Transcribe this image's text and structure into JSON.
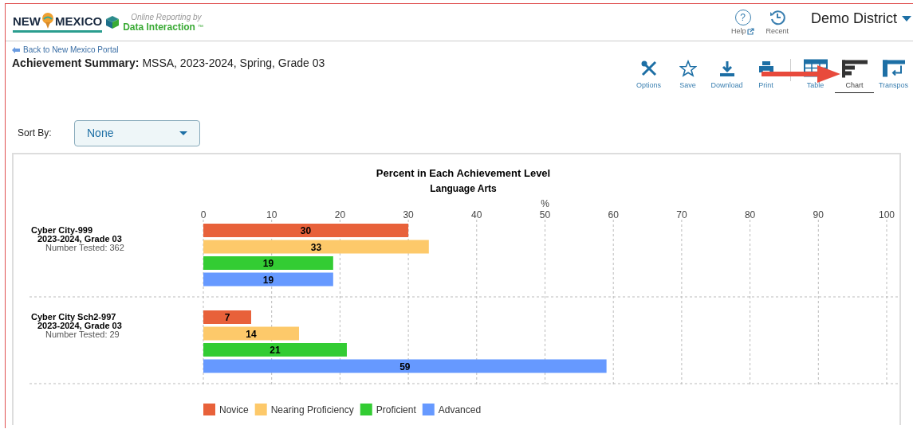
{
  "header": {
    "logo": {
      "state": "NEW",
      "state2": "MEXICO",
      "tagline": "Online Reporting by",
      "brand": "Data Interaction",
      "tm": "™"
    },
    "help": {
      "icon": "?",
      "label": "Help"
    },
    "recent": {
      "label": "Recent"
    },
    "district": "Demo District"
  },
  "back_link": "Back to New Mexico Portal",
  "title": {
    "label": "Achievement Summary:",
    "value": "MSSA, 2023-2024, Spring, Grade 03"
  },
  "actions": [
    {
      "label": "Options"
    },
    {
      "label": "Save"
    },
    {
      "label": "Download"
    },
    {
      "label": "Print"
    }
  ],
  "views": [
    {
      "label": "Table",
      "selected": false
    },
    {
      "label": "Chart",
      "selected": true
    },
    {
      "label": "Transpos",
      "selected": false
    }
  ],
  "sort": {
    "label": "Sort By:",
    "value": "None"
  },
  "chart": {
    "subtitle": "Language Arts",
    "rows": [
      {
        "period": "2023-2024, Grade 03",
        "tested": "Number Tested: 362"
      },
      {
        "period": "2023-2024, Grade 03",
        "tested": "Number Tested: 29"
      }
    ],
    "chart_data": {
      "type": "bar",
      "orientation": "horizontal",
      "title": "Percent in Each Achievement Level",
      "xlabel": "%",
      "categories": [
        "Cyber City-999",
        "Cyber City Sch2-997"
      ],
      "series": [
        {
          "name": "Novice",
          "color": "#e8613a",
          "values": [
            30,
            7
          ]
        },
        {
          "name": "Nearing Proficiency",
          "color": "#fdc96a",
          "values": [
            33,
            14
          ]
        },
        {
          "name": "Proficient",
          "color": "#33cc33",
          "values": [
            19,
            21
          ]
        },
        {
          "name": "Advanced",
          "color": "#6699ff",
          "values": [
            19,
            59
          ]
        }
      ],
      "xlim": [
        0,
        100
      ],
      "grid": true,
      "legend": true,
      "xticks": [
        0,
        10,
        20,
        30,
        40,
        50,
        60,
        70,
        80,
        90,
        100
      ],
      "data_labels": true
    }
  }
}
